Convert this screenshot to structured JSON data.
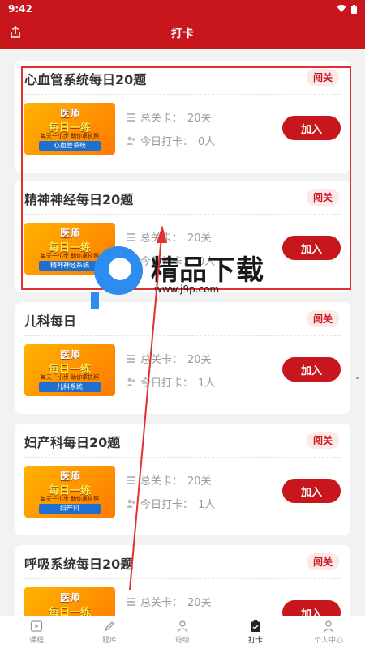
{
  "status_bar": {
    "time": "9:42"
  },
  "header": {
    "title": "打卡"
  },
  "labels": {
    "total_levels": "总关卡：",
    "today_checkin": "今日打卡："
  },
  "cards": [
    {
      "title": "心血管系统每日20题",
      "badge": "闯关",
      "thumb_title": "医师",
      "thumb_subtitle": "每日一练",
      "thumb_small": "每天一小步 助你拿执照",
      "category": "心血管系统",
      "total_levels": "20关",
      "today": "0人",
      "button": "加入"
    },
    {
      "title": "精神神经每日20题",
      "badge": "闯关",
      "thumb_title": "医师",
      "thumb_subtitle": "每日一练",
      "thumb_small": "每天一小步 助你拿执照",
      "category": "精神神经系统",
      "total_levels": "20关",
      "today": "0人",
      "button": "加入"
    },
    {
      "title": "儿科每日",
      "badge": "闯关",
      "thumb_title": "医师",
      "thumb_subtitle": "每日一练",
      "thumb_small": "每天一小步 助你拿执照",
      "category": "儿科系统",
      "total_levels": "20关",
      "today": "1人",
      "button": "加入"
    },
    {
      "title": "妇产科每日20题",
      "badge": "闯关",
      "thumb_title": "医师",
      "thumb_subtitle": "每日一练",
      "thumb_small": "每天一小步 助你拿执照",
      "category": "妇产科",
      "total_levels": "20关",
      "today": "1人",
      "button": "加入"
    },
    {
      "title": "呼吸系统每日20题",
      "badge": "闯关",
      "thumb_title": "医师",
      "thumb_subtitle": "每日一练",
      "thumb_small": "",
      "category": "",
      "total_levels": "20关",
      "today": "",
      "button": "加入"
    }
  ],
  "watermark": {
    "text": "精品下载",
    "url": "www.j9p.com"
  },
  "nav": [
    {
      "label": "课程",
      "icon": "play-icon"
    },
    {
      "label": "题库",
      "icon": "pencil-icon"
    },
    {
      "label": "班级",
      "icon": "group-icon"
    },
    {
      "label": "打卡",
      "icon": "clipboard-icon"
    },
    {
      "label": "个人中心",
      "icon": "user-icon"
    }
  ],
  "colors": {
    "primary": "#c8161d",
    "badge_bg": "#fde8e8",
    "highlight": "#e03030"
  }
}
